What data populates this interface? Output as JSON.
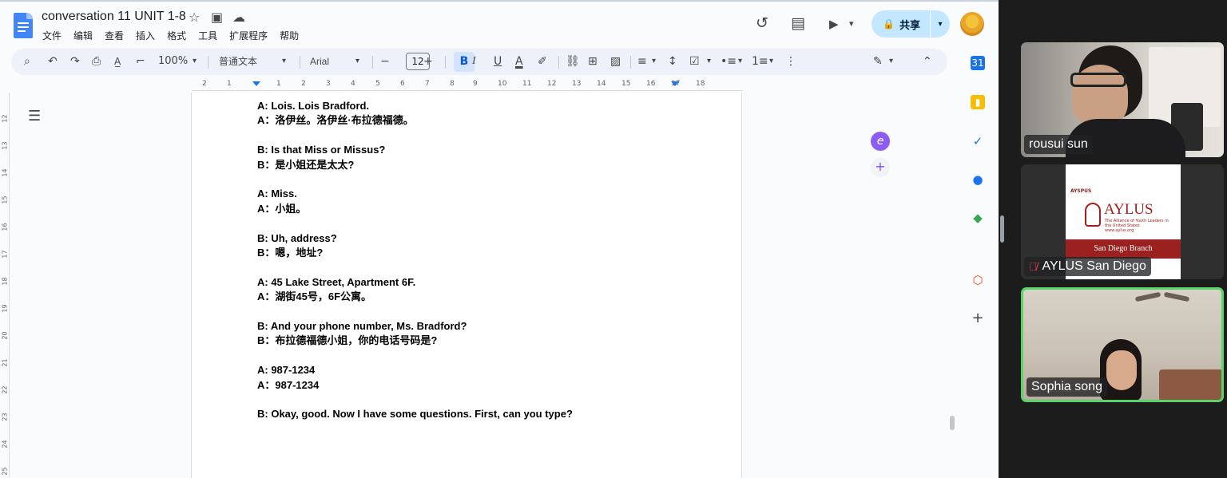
{
  "docs": {
    "title": "conversation 11 UNIT 1-8",
    "menu": [
      "文件",
      "编辑",
      "查看",
      "插入",
      "格式",
      "工具",
      "扩展程序",
      "帮助"
    ],
    "share_label": "共享",
    "toolbar": {
      "zoom": "100%",
      "style": "普通文本",
      "font": "Arial",
      "font_size": "12",
      "minus": "−",
      "plus": "+",
      "bold": "B",
      "italic": "I",
      "underline": "U",
      "text_color": "A"
    },
    "ruler_numbers": [
      "2",
      "1",
      "1",
      "2",
      "3",
      "4",
      "5",
      "6",
      "7",
      "8",
      "9",
      "10",
      "11",
      "12",
      "13",
      "14",
      "15",
      "16",
      "17",
      "18"
    ],
    "vruler_numbers": [
      "12",
      "13",
      "14",
      "15",
      "16",
      "17",
      "18",
      "19",
      "20",
      "21",
      "22",
      "23",
      "24",
      "25"
    ],
    "lines": [
      [
        "A: Lois. Lois Bradford.",
        "A：洛伊丝。洛伊丝·布拉德福德。"
      ],
      [
        "B: Is that Miss or Missus?",
        "B：是小姐还是太太?"
      ],
      [
        "A: Miss.",
        "A：小姐。"
      ],
      [
        "B: Uh, address?",
        "B：嗯，地址?"
      ],
      [
        "A: 45 Lake Street, Apartment 6F.",
        "A：湖街45号，6F公寓。"
      ],
      [
        "B: And your phone number, Ms. Bradford?",
        "B：布拉德福德小姐，你的电话号码是?"
      ],
      [
        "A: 987-1234",
        "A：987-1234"
      ],
      [
        "B: Okay, good. Now I have some questions. First, can you type?"
      ]
    ]
  },
  "meet": {
    "participants": [
      {
        "name": "rousui sun",
        "muted": false,
        "active": false
      },
      {
        "name": "AYLUS San Diego",
        "muted": true,
        "active": false
      },
      {
        "name": "Sophia song",
        "muted": false,
        "active": true
      }
    ],
    "aylus_card": {
      "small": "AYSPUS",
      "logo": "AYLUS",
      "tagline": "The Alliance of Youth Leaders in the United States",
      "url": "www.aylus.org",
      "branch": "San Diego Branch"
    }
  },
  "colors": {
    "accent": "#0b57d0",
    "share_bg": "#c2e7ff",
    "active_speaker": "#5bd36b",
    "aylus_red": "#9b2121"
  },
  "icons": {
    "star": "☆",
    "folder": "▣",
    "cloud": "☁",
    "history": "↺",
    "comment": "▤",
    "video": "▶",
    "lock": "🔒",
    "caret": "▾",
    "search": "⌕",
    "undo": "↶",
    "redo": "↷",
    "print": "⎙",
    "outline": "☰",
    "plus": "+",
    "edit": "✎",
    "collapse": "⌃",
    "more": "⋮",
    "mic_off": "🎙"
  }
}
